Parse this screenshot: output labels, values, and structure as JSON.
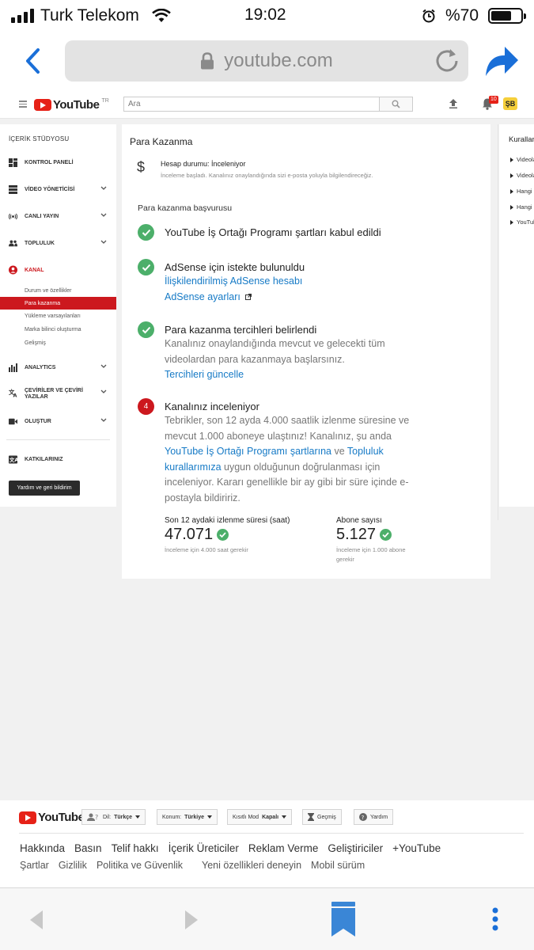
{
  "status_bar": {
    "carrier": "Turk Telekom",
    "time": "19:02",
    "battery_percent": "%70",
    "battery_level": 0.7
  },
  "browser": {
    "url": "youtube.com"
  },
  "header": {
    "logo_text": "YouTube",
    "logo_country": "TR",
    "search_placeholder": "Ara",
    "notification_count": "10",
    "avatar_initials": "ŞB"
  },
  "sidebar": {
    "title": "İÇERİK STÜDYOSU",
    "items": [
      {
        "label": "KONTROL PANELİ",
        "icon": "dashboard-icon"
      },
      {
        "label": "VİDEO YÖNETİCİSİ",
        "icon": "video-manager-icon"
      },
      {
        "label": "CANLI YAYIN",
        "icon": "live-icon"
      },
      {
        "label": "TOPLULUK",
        "icon": "community-icon"
      },
      {
        "label": "KANAL",
        "icon": "channel-icon"
      },
      {
        "label": "ANALYTICS",
        "icon": "analytics-icon"
      },
      {
        "label": "ÇEVİRİLER VE ÇEVİRİ YAZILAR",
        "icon": "translate-icon"
      },
      {
        "label": "OLUŞTUR",
        "icon": "create-icon"
      },
      {
        "label": "KATKILARINIZ",
        "icon": "contributions-icon"
      }
    ],
    "channel_sub": [
      "Durum ve özellikler",
      "Para kazanma",
      "Yükleme varsayılanları",
      "Marka bilinci oluşturma",
      "Gelişmiş"
    ],
    "feedback_label": "Yardım ve geri bildirim"
  },
  "main": {
    "title": "Para Kazanma",
    "account_status": "Hesap durumu: İnceleniyor",
    "account_note": "İnceleme başladı. Kanalınız onaylandığında sizi e-posta yoluyla bilgilendireceğiz.",
    "section_title": "Para kazanma başvurusu",
    "steps": [
      {
        "title": "YouTube İş Ortağı Programı şartları kabul edildi"
      },
      {
        "title": "AdSense için istekte bulunuldu",
        "link1": "İlişkilendirilmiş AdSense hesabı",
        "link2": "AdSense ayarları"
      },
      {
        "title": "Para kazanma tercihleri belirlendi",
        "desc": "Kanalınız onaylandığında mevcut ve gelecekti tüm videolardan para kazanmaya başlarsınız.",
        "link": "Tercihleri güncelle"
      },
      {
        "number": "4",
        "title": "Kanalınız inceleniyor",
        "desc_a": "Tebrikler, son 12 ayda 4.000 saatlik izlenme süresine ve mevcut 1.000 aboneye ulaştınız! Kanalınız, şu anda ",
        "link_a": "YouTube İş Ortağı Programı şartlarına",
        "desc_b": " ve ",
        "link_b": "Topluluk kurallarımıza",
        "desc_c": " uygun olduğunun doğrulanması için inceleniyor. Kararı genellikle bir ay gibi bir süre içinde e-postayla bildiririz."
      }
    ],
    "stats": [
      {
        "label": "Son 12 aydaki izlenme süresi (saat)",
        "value": "47.071",
        "note": "İnceleme için 4.000 saat gerekir"
      },
      {
        "label": "Abone sayısı",
        "value": "5.127",
        "note": "İnceleme için 1.000 abone gerekir"
      }
    ]
  },
  "right_panel": {
    "title": "Kurallar",
    "items": [
      "Videolar",
      "Videolar",
      "Hangi",
      "Hangi",
      "YouTube"
    ]
  },
  "footer": {
    "logo_text": "YouTube",
    "language_label": "Dil:",
    "language_value": "Türkçe",
    "location_label": "Konum:",
    "location_value": "Türkiye",
    "restricted_label": "Kısıtlı Mod",
    "restricted_value": "Kapalı",
    "history_label": "Geçmiş",
    "help_label": "Yardım",
    "links_primary": [
      "Hakkında",
      "Basın",
      "Telif hakkı",
      "İçerik Üreticiler",
      "Reklam Verme",
      "Geliştiriciler",
      "+YouTube"
    ],
    "links_secondary": [
      "Şartlar",
      "Gizlilik",
      "Politika ve Güvenlik",
      "Yeni özellikleri deneyin",
      "Mobil sürüm"
    ]
  },
  "colors": {
    "brand_red": "#e62117",
    "active_red": "#cc181e",
    "link_blue": "#167ac6",
    "success_green": "#4caf6a",
    "ios_blue": "#1a6fd8"
  }
}
